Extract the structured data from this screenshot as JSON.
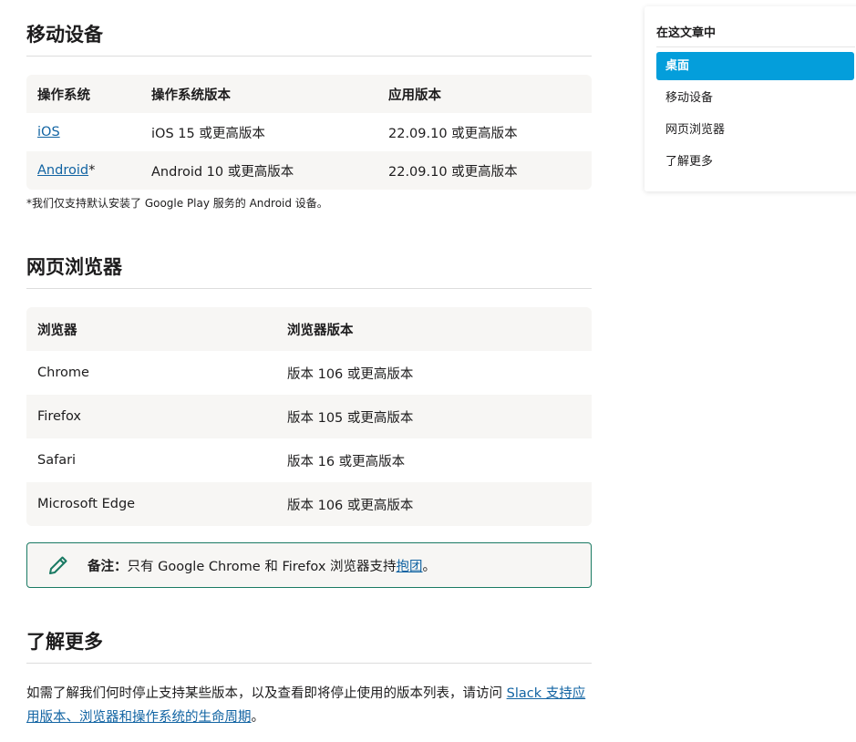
{
  "sections": {
    "mobile": {
      "title": "移动设备",
      "headers": [
        "操作系统",
        "操作系统版本",
        "应用版本"
      ],
      "rows": [
        {
          "os": "iOS",
          "os_suffix": "",
          "version": "iOS 15 或更高版本",
          "app": "22.09.10 或更高版本"
        },
        {
          "os": "Android",
          "os_suffix": "*",
          "version": "Android 10 或更高版本",
          "app": "22.09.10 或更高版本"
        }
      ],
      "footnote": "*我们仅支持默认安装了 Google Play 服务的 Android 设备。"
    },
    "browser": {
      "title": "网页浏览器",
      "headers": [
        "浏览器",
        "浏览器版本"
      ],
      "rows": [
        {
          "name": "Chrome",
          "version": "版本 106 或更高版本"
        },
        {
          "name": "Firefox",
          "version": "版本 105 或更高版本"
        },
        {
          "name": "Safari",
          "version": "版本 16 或更高版本"
        },
        {
          "name": "Microsoft Edge",
          "version": "版本 106 或更高版本"
        }
      ]
    },
    "note": {
      "icon": "pencil-icon",
      "label": "备注：",
      "text": "只有 Google Chrome 和 Firefox 浏览器支持",
      "link": "抱团",
      "end": "。"
    },
    "learn": {
      "title": "了解更多",
      "text": "如需了解我们何时停止支持某些版本，以及查看即将停止使用的版本列表，请访问 ",
      "link": "Slack 支持应用版本、浏览器和操作系统的生命周期",
      "end": "。"
    }
  },
  "toc": {
    "title": "在这文章中",
    "items": [
      "桌面",
      "移动设备",
      "网页浏览器",
      "了解更多"
    ],
    "active_index": 0
  },
  "colors": {
    "accent": "#049edb",
    "link": "#1264a3",
    "note_border": "#1a7a63"
  }
}
